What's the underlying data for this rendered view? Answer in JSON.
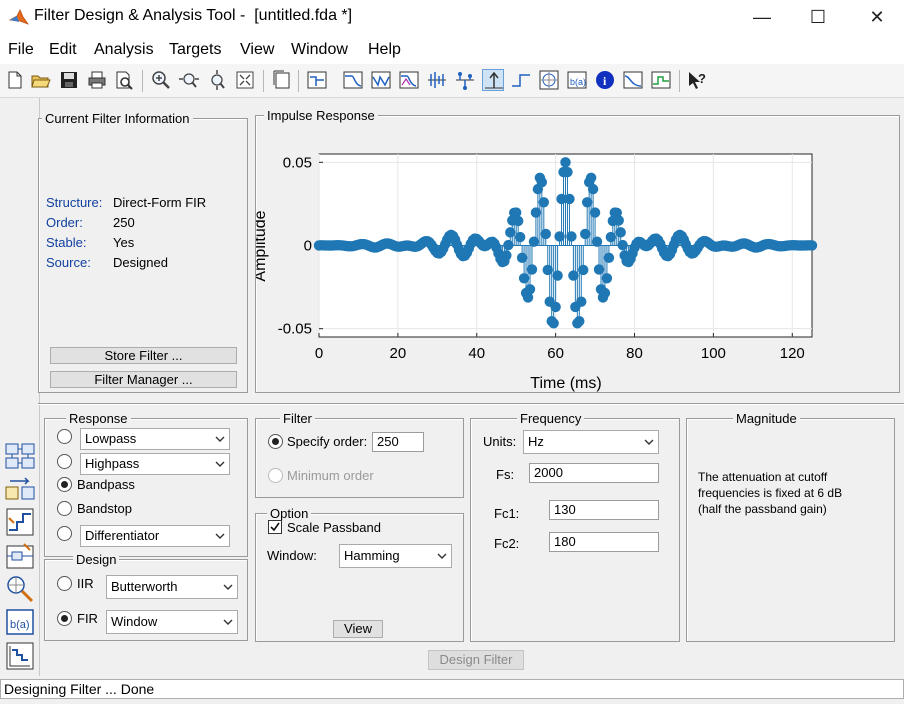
{
  "window": {
    "title": "Filter Design & Analysis Tool -  [untitled.fda *]",
    "minimize": "—",
    "maximize": "☐",
    "close": "✕"
  },
  "menu": [
    "File",
    "Edit",
    "Analysis",
    "Targets",
    "View",
    "Window",
    "Help"
  ],
  "toolbar_icons": [
    "new-icon",
    "open-icon",
    "save-icon",
    "print-icon",
    "print-preview-icon",
    "zoom-in-icon",
    "zoom-x-icon",
    "zoom-y-icon",
    "full-view-icon",
    "new-plot-icon",
    "filter-specs-icon",
    "magnitude-response-icon",
    "phase-response-icon",
    "mag-phase-icon",
    "group-delay-icon",
    "phase-delay-icon",
    "impulse-response-icon",
    "step-response-icon",
    "pole-zero-icon",
    "filter-coefficients-icon",
    "filter-info-icon",
    "magnitude-estimate-icon",
    "round-off-noise-icon",
    "whats-this-icon"
  ],
  "side_icons": [
    "design-filter-icon",
    "transform-filter-icon",
    "create-multirate-icon",
    "realize-model-icon",
    "import-filter-icon",
    "pole-zero-editor-icon",
    "quantization-icon"
  ],
  "filter_info": {
    "title": "Current Filter Information",
    "rows": [
      {
        "label": "Structure:",
        "value": "Direct-Form FIR"
      },
      {
        "label": "Order:",
        "value": "250"
      },
      {
        "label": "Stable:",
        "value": "Yes"
      },
      {
        "label": "Source:",
        "value": "Designed"
      }
    ],
    "store_button": "Store Filter ...",
    "manager_button": "Filter Manager ..."
  },
  "plot_panel": {
    "title": "Impulse Response"
  },
  "chart_data": {
    "type": "stem",
    "title": "",
    "xlabel": "Time (ms)",
    "ylabel": "Amplitude",
    "xlim": [
      0,
      125
    ],
    "ylim": [
      -0.055,
      0.055
    ],
    "xticks": [
      "0",
      "20",
      "40",
      "60",
      "80",
      "100",
      "120"
    ],
    "yticks": [
      "0.05",
      "0",
      "-0.05"
    ],
    "grid": true,
    "sample_period_ms": 0.5,
    "num_samples": 251,
    "description_values": "Bandpass Hamming-window FIR, fc1=130 Hz, fc2=180 Hz, fs=2000 Hz, centered at 62.5 ms, peak ≈ 0.05",
    "color": "#1f77b4"
  },
  "response": {
    "title": "Response",
    "lowpass": "Lowpass",
    "highpass": "Highpass",
    "bandpass": "Bandpass",
    "bandstop": "Bandstop",
    "differentiator": "Differentiator",
    "selected": "Bandpass"
  },
  "design": {
    "title": "Design",
    "iir_label": "IIR",
    "iir_value": "Butterworth",
    "fir_label": "FIR",
    "fir_value": "Window",
    "selected": "FIR"
  },
  "filter_order": {
    "title": "Filter",
    "specify_label": "Specify order:",
    "order_value": "250",
    "minimum_label": "Minimum order"
  },
  "options": {
    "title": "Option",
    "scale_label": "Scale Passband",
    "window_label": "Window:",
    "window_value": "Hamming",
    "view_button": "View"
  },
  "frequency": {
    "title": "Frequency",
    "units_label": "Units:",
    "units_value": "Hz",
    "fs_label": "Fs:",
    "fs_value": "2000",
    "fc1_label": "Fc1:",
    "fc1_value": "130",
    "fc2_label": "Fc2:",
    "fc2_value": "180"
  },
  "magnitude": {
    "title": "Magnitude",
    "text": "The attenuation at cutoff frequencies is fixed at 6 dB (half the passband gain)"
  },
  "design_button": "Design Filter",
  "status": "Designing Filter ... Done"
}
